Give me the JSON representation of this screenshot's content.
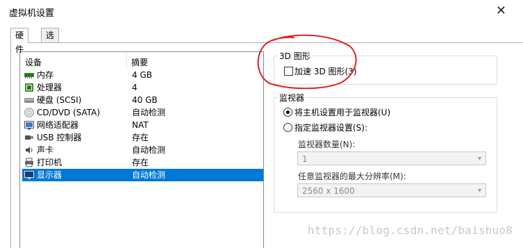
{
  "window": {
    "title": "虚拟机设置"
  },
  "tabs": [
    {
      "label": "硬件"
    },
    {
      "label": "选项"
    }
  ],
  "device_table": {
    "columns": [
      "设备",
      "摘要"
    ],
    "rows": [
      {
        "device": "内存",
        "summary": "4 GB",
        "icon": "memory-icon"
      },
      {
        "device": "处理器",
        "summary": "4",
        "icon": "cpu-icon"
      },
      {
        "device": "硬盘 (SCSI)",
        "summary": "40 GB",
        "icon": "harddisk-icon"
      },
      {
        "device": "CD/DVD (SATA)",
        "summary": "自动检测",
        "icon": "cd-icon"
      },
      {
        "device": "网络适配器",
        "summary": "NAT",
        "icon": "network-icon"
      },
      {
        "device": "USB 控制器",
        "summary": "存在",
        "icon": "usb-icon"
      },
      {
        "device": "声卡",
        "summary": "自动检测",
        "icon": "sound-icon"
      },
      {
        "device": "打印机",
        "summary": "存在",
        "icon": "printer-icon"
      },
      {
        "device": "显示器",
        "summary": "自动检测",
        "icon": "display-icon"
      }
    ],
    "selected": "显示器"
  },
  "graphics_3d": {
    "group_label": "3D 图形",
    "accelerate_label": "加速 3D 图形(3)",
    "accelerate_checked": false
  },
  "monitor": {
    "group_label": "监视器",
    "option_host": "将主机设置用于监视器(U)",
    "option_custom": "指定监视器设置(S):",
    "selected_option": "将主机设置用于监视器(U)",
    "count_label": "监视器数量(N):",
    "count_value": "1",
    "resolution_label": "任意监视器的最大分辨率(M):",
    "resolution_value": "2560 x 1600"
  },
  "colors": {
    "selection": "#0078d7",
    "annotation": "#e02020"
  },
  "watermark": "https://blog.csdn.net/baishuo8"
}
